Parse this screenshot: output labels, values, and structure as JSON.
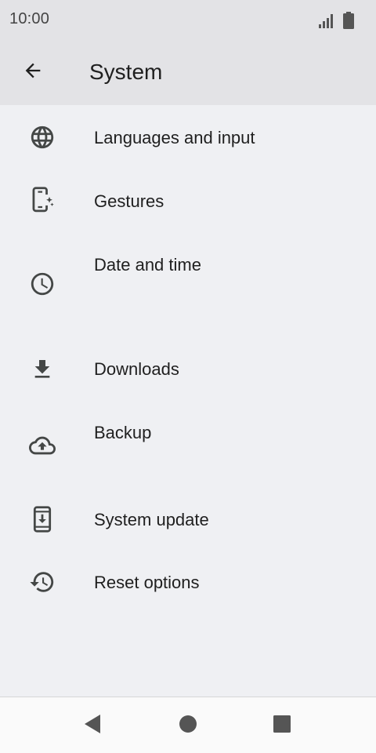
{
  "status_bar": {
    "time": "10:00",
    "icons": [
      "signal-icon",
      "battery-icon"
    ]
  },
  "app_bar": {
    "back_icon": "arrow-left-icon",
    "title": "System"
  },
  "settings": [
    {
      "label": "Languages and input",
      "icon": "globe-icon"
    },
    {
      "label": "Gestures",
      "icon": "phone-gesture-icon"
    },
    {
      "label": "Date and time",
      "icon": "clock-icon"
    },
    {
      "label": "Downloads",
      "icon": "download-icon"
    },
    {
      "label": "Backup",
      "icon": "cloud-upload-icon"
    },
    {
      "label": "System update",
      "icon": "phone-update-icon"
    },
    {
      "label": "Reset options",
      "icon": "history-icon"
    }
  ],
  "nav_bar": {
    "buttons": [
      "back-triangle-icon",
      "home-circle-icon",
      "recents-square-icon"
    ]
  },
  "colors": {
    "header_bg": "#e3e3e6",
    "page_bg": "#eff0f3",
    "text": "#1f1f1f",
    "icon": "#444746",
    "nav_bg": "#fafafa"
  }
}
